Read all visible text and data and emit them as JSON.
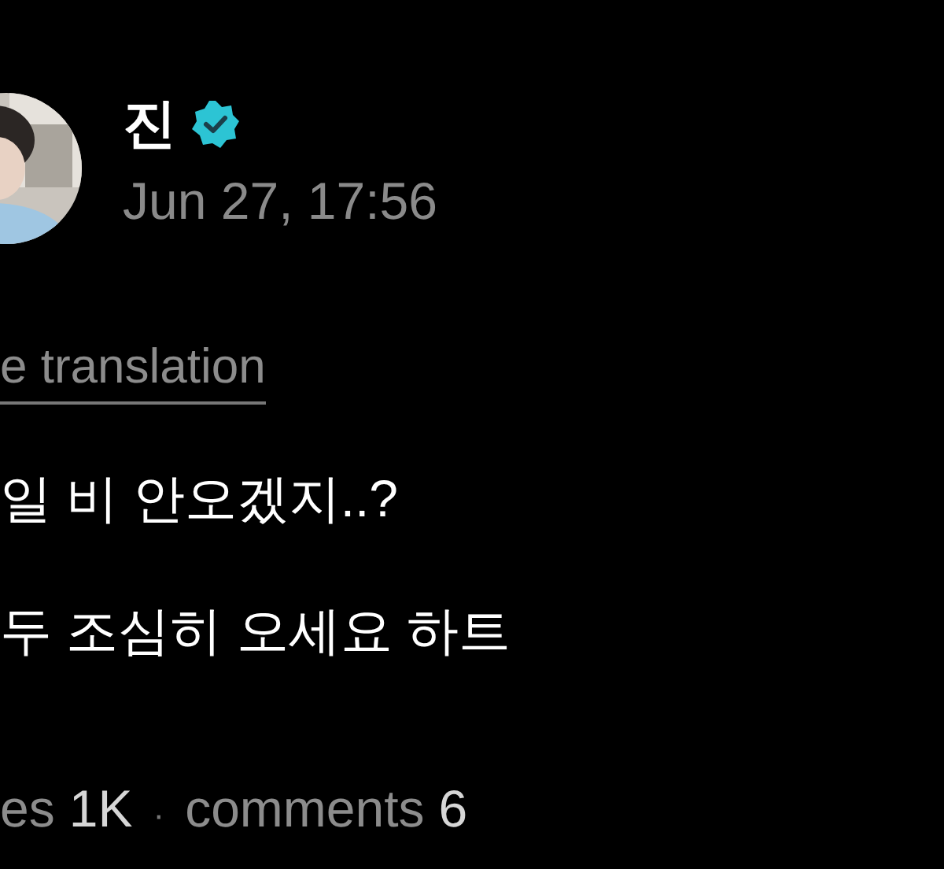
{
  "post": {
    "author": "진",
    "verified": true,
    "date": "Jun 27, 17:56"
  },
  "translation_link": "e translation",
  "body_lines": [
    "일 비 안오겠지..?",
    "두 조심히 오세요 하트"
  ],
  "stats": {
    "likes_label": "es",
    "likes_count": "1K",
    "separator": "·",
    "comments_label": "comments",
    "comments_count": "6"
  }
}
